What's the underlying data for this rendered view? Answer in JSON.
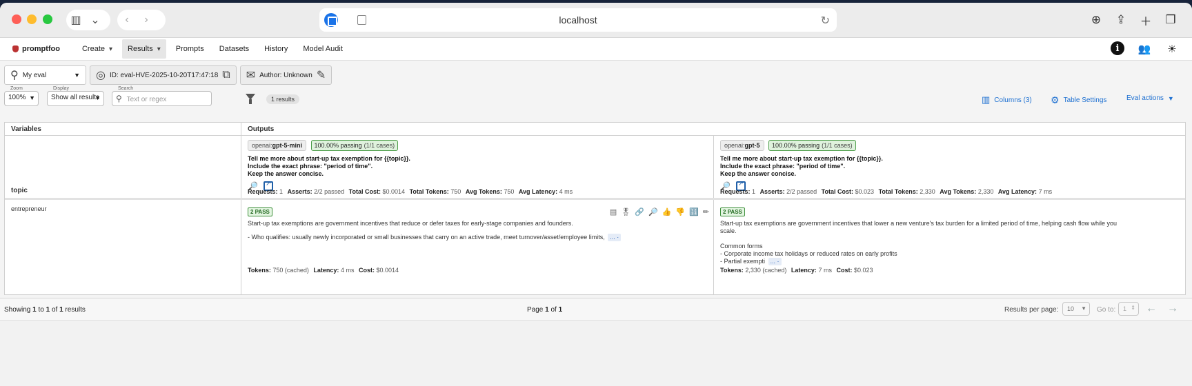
{
  "browser": {
    "url": "localhost"
  },
  "nav": {
    "logo": "promptfoo",
    "items": [
      {
        "label": "Create"
      },
      {
        "label": "Results"
      },
      {
        "label": "Prompts"
      },
      {
        "label": "Datasets"
      },
      {
        "label": "History"
      },
      {
        "label": "Model Audit"
      }
    ]
  },
  "eval": {
    "selector": "My eval",
    "id": "ID: eval-HVE-2025-10-20T17:47:18",
    "author": "Author: Unknown"
  },
  "filters": {
    "zoom_label": "Zoom",
    "zoom_value": "100%",
    "display_label": "Display",
    "display_value": "Show all results",
    "search_label": "Search",
    "search_placeholder": "Text or regex",
    "results_count": "1 results",
    "columns": "Columns (3)",
    "table_settings": "Table Settings",
    "eval_actions": "Eval actions"
  },
  "table": {
    "headers": {
      "variables": "Variables",
      "outputs": "Outputs"
    },
    "var_name": "topic",
    "providers": [
      {
        "prefix": "openai:",
        "model": "gpt-5-mini",
        "passing": "100.00% passing",
        "cases": "(1/1 cases)",
        "prompt": [
          "Tell me more about start-up tax exemption for {{topic}}.",
          "Include the exact phrase: \"period of time\".",
          "Keep the answer concise."
        ],
        "stats": {
          "requests": "1",
          "asserts": "2/2 passed",
          "total_cost": "$0.0014",
          "total_tokens": "750",
          "avg_tokens": "750",
          "avg_latency": "4 ms"
        }
      },
      {
        "prefix": "openai:",
        "model": "gpt-5",
        "passing": "100.00% passing",
        "cases": "(1/1 cases)",
        "prompt": [
          "Tell me more about start-up tax exemption for {{topic}}.",
          "Include the exact phrase: \"period of time\".",
          "Keep the answer concise."
        ],
        "stats": {
          "requests": "1",
          "asserts": "2/2 passed",
          "total_cost": "$0.023",
          "total_tokens": "2,330",
          "avg_tokens": "2,330",
          "avg_latency": "7 ms"
        }
      }
    ],
    "stat_labels": {
      "requests": "Requests:",
      "asserts": "Asserts:",
      "total_cost": "Total Cost:",
      "total_tokens": "Total Tokens:",
      "avg_tokens": "Avg Tokens:",
      "avg_latency": "Avg Latency:"
    },
    "row": {
      "var_value": "entrepreneur",
      "outputs": [
        {
          "badge": "2 PASS",
          "lines": [
            "Start-up tax exemptions are government incentives that reduce or defer taxes for early-stage companies and founders.",
            "- Who qualifies: usually newly incorporated or small businesses that carry on an active trade, meet turnover/asset/employee limits,"
          ],
          "more": "... ·",
          "tokens": "750 (cached)",
          "latency": "4 ms",
          "cost": "$0.0014"
        },
        {
          "badge": "2 PASS",
          "lines": [
            "Start-up tax exemptions are government incentives that lower a new venture's tax burden for a limited period of time, helping cash flow while you",
            "scale.",
            "Common forms",
            "- Corporate income tax holidays or reduced rates on early profits",
            "- Partial exempti"
          ],
          "more": "... ·",
          "tokens": "2,330 (cached)",
          "latency": "7 ms",
          "cost": "$0.023"
        }
      ],
      "out_labels": {
        "tokens": "Tokens:",
        "latency": "Latency:",
        "cost": "Cost:"
      }
    }
  },
  "footer": {
    "showing_prefix": "Showing",
    "from": "1",
    "to_word": "to",
    "to": "1",
    "of_word": "of",
    "total": "1",
    "results_word": "results",
    "page_prefix": "Page",
    "page": "1",
    "page_of": "of",
    "pages": "1",
    "rpp_label": "Results per page:",
    "rpp_value": "10",
    "goto_label": "Go to:",
    "goto_value": "1"
  }
}
